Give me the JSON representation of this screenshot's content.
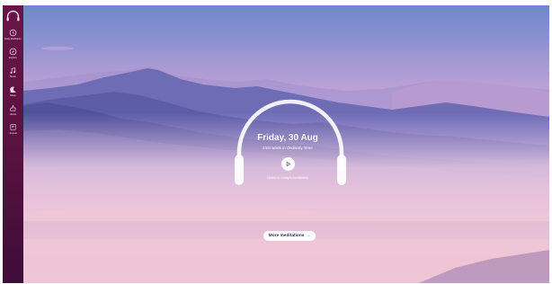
{
  "sidebar": {
    "items": [
      {
        "label": "Daily Meditation",
        "icon": "clock-icon"
      },
      {
        "label": "Explore",
        "icon": "compass-icon"
      },
      {
        "label": "Music",
        "icon": "music-note-icon"
      },
      {
        "label": "Sleep",
        "icon": "sleep-icon"
      },
      {
        "label": "Hands",
        "icon": "hand-icon"
      },
      {
        "label": "Journal",
        "icon": "journal-icon"
      }
    ]
  },
  "hero": {
    "title": "Friday, 30 Aug",
    "subtitle": "21st week in Ordinary Time",
    "listen_text": "Listen to today's meditation",
    "more_label": "More meditations",
    "more_arrow": "→"
  },
  "colors": {
    "sidebar": "#5a1240",
    "accent_text": "#3b2a55",
    "white": "#ffffff"
  }
}
